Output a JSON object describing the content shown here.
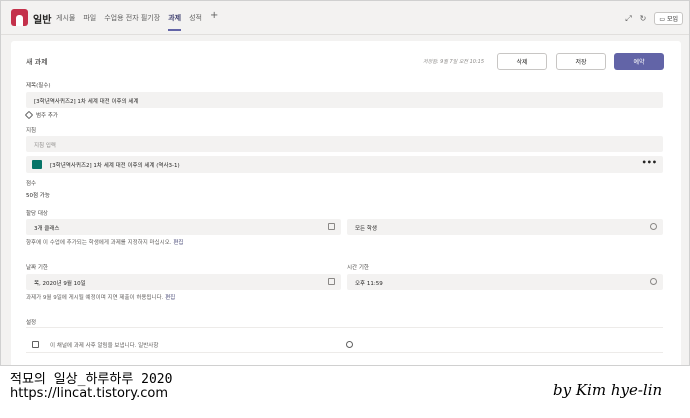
{
  "header": {
    "team_name": "일반",
    "tabs": [
      "게시물",
      "파일",
      "수업용 전자 필기장",
      "과제",
      "성적"
    ],
    "active_tab": "과제",
    "meet_label": "모임"
  },
  "form": {
    "title": "새 과제",
    "saved_note": "저장됨: 9월 7일 오전 10:15",
    "buttons": {
      "delete": "삭제",
      "save": "저장",
      "schedule": "예약"
    },
    "title_label": "제목(필수)",
    "title_value": "[3학년역사퀴즈2] 1차 세계 대전 이후의 세계",
    "category_add": "범주 추가",
    "instructions_label": "지침",
    "instructions_placeholder": "지침 입력",
    "attachment": "[3학년역사퀴즈2] 1차 세계 대전 이후의 세계 (역사3-1)",
    "points_label": "점수",
    "points_value": "50점 가능",
    "assign_label": "할당 대상",
    "assign_class": "3개 클래스",
    "assign_students": "모든 학생",
    "assign_note": "향후에 이 수업에 추가되는 학생에게 과제를 지정하지 마십시오.",
    "assign_note_link": "편집",
    "due_date_label": "날짜 기한",
    "due_date_value": "목, 2020년 9월 10일",
    "due_time_label": "시간 기한",
    "due_time_value": "오후 11:59",
    "due_note": "과제가 9월 9일에 게시될 예정이며 지연 제출이 허용됩니다.",
    "due_note_link": "편집",
    "settings_label": "설정",
    "settings_row": "이 채널에 과제 사후 알림을 보냅니다. 일반사항"
  },
  "watermark": {
    "line1": "적묘의 일상_하루하루 2020",
    "line2": "https://lincat.tistory.com",
    "signature": "by Kim hye-lin"
  }
}
